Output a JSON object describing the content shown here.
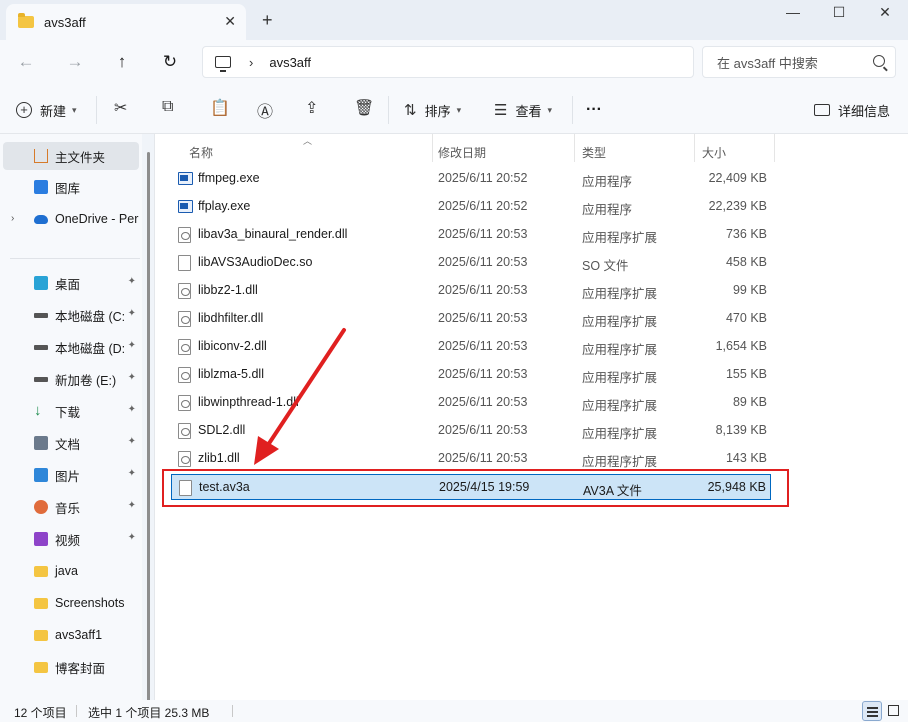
{
  "window": {
    "tab_title": "avs3aff",
    "new_tab": "+",
    "close_tab": "✕",
    "minimize": "—",
    "maximize": "☐",
    "close": "✕"
  },
  "nav": {
    "back": "←",
    "forward": "→",
    "up": "↑",
    "refresh": "↻",
    "breadcrumb_sep": "›",
    "breadcrumb": "avs3aff",
    "search_placeholder": "在 avs3aff 中搜索"
  },
  "toolbar": {
    "new_label": "新建",
    "sort_label": "排序",
    "view_label": "查看",
    "more": "···",
    "details_label": "详细信息"
  },
  "sidebar": {
    "items": [
      {
        "label": "主文件夹",
        "icon": "home-icon",
        "selected": true
      },
      {
        "label": "图库",
        "icon": "gallery-icon"
      },
      {
        "label": "OneDrive - Per",
        "icon": "onedrive-icon"
      },
      {
        "label": "桌面",
        "icon": "desktop-icon",
        "pinned": true
      },
      {
        "label": "本地磁盘 (C:",
        "icon": "drive-icon",
        "pinned": true
      },
      {
        "label": "本地磁盘 (D:",
        "icon": "drive-icon",
        "pinned": true
      },
      {
        "label": "新加卷 (E:)",
        "icon": "drive-icon",
        "pinned": true
      },
      {
        "label": "下载",
        "icon": "download-icon",
        "pinned": true
      },
      {
        "label": "文档",
        "icon": "document-icon",
        "pinned": true
      },
      {
        "label": "图片",
        "icon": "pictures-icon",
        "pinned": true
      },
      {
        "label": "音乐",
        "icon": "music-icon",
        "pinned": true
      },
      {
        "label": "视频",
        "icon": "video-icon",
        "pinned": true
      },
      {
        "label": "java",
        "icon": "folder-icon"
      },
      {
        "label": "Screenshots",
        "icon": "folder-icon"
      },
      {
        "label": "avs3aff1",
        "icon": "folder-icon"
      },
      {
        "label": "博客封面",
        "icon": "folder-icon"
      }
    ],
    "expander": "›",
    "pin_glyph": "📌"
  },
  "columns": {
    "name": "名称",
    "modified": "修改日期",
    "type": "类型",
    "size": "大小"
  },
  "files": [
    {
      "name": "ffmpeg.exe",
      "date": "2025/6/11 20:52",
      "type": "应用程序",
      "size": "22,409 KB",
      "kind": "exe"
    },
    {
      "name": "ffplay.exe",
      "date": "2025/6/11 20:52",
      "type": "应用程序",
      "size": "22,239 KB",
      "kind": "exe"
    },
    {
      "name": "libav3a_binaural_render.dll",
      "date": "2025/6/11 20:53",
      "type": "应用程序扩展",
      "size": "736 KB",
      "kind": "dll"
    },
    {
      "name": "libAVS3AudioDec.so",
      "date": "2025/6/11 20:53",
      "type": "SO 文件",
      "size": "458 KB",
      "kind": "file"
    },
    {
      "name": "libbz2-1.dll",
      "date": "2025/6/11 20:53",
      "type": "应用程序扩展",
      "size": "99 KB",
      "kind": "dll"
    },
    {
      "name": "libdhfilter.dll",
      "date": "2025/6/11 20:53",
      "type": "应用程序扩展",
      "size": "470 KB",
      "kind": "dll"
    },
    {
      "name": "libiconv-2.dll",
      "date": "2025/6/11 20:53",
      "type": "应用程序扩展",
      "size": "1,654 KB",
      "kind": "dll"
    },
    {
      "name": "liblzma-5.dll",
      "date": "2025/6/11 20:53",
      "type": "应用程序扩展",
      "size": "155 KB",
      "kind": "dll"
    },
    {
      "name": "libwinpthread-1.dll",
      "date": "2025/6/11 20:53",
      "type": "应用程序扩展",
      "size": "89 KB",
      "kind": "dll"
    },
    {
      "name": "SDL2.dll",
      "date": "2025/6/11 20:53",
      "type": "应用程序扩展",
      "size": "8,139 KB",
      "kind": "dll"
    },
    {
      "name": "zlib1.dll",
      "date": "2025/6/11 20:53",
      "type": "应用程序扩展",
      "size": "143 KB",
      "kind": "dll"
    },
    {
      "name": "test.av3a",
      "date": "2025/4/15 19:59",
      "type": "AV3A 文件",
      "size": "25,948 KB",
      "kind": "file",
      "selected": true
    }
  ],
  "status": {
    "count": "12 个项目",
    "selection": "选中 1 个项目  25.3 MB"
  },
  "colors": {
    "selection_bg": "#cce4f7",
    "selection_border": "#0067c0",
    "annotation_red": "#e02020"
  }
}
